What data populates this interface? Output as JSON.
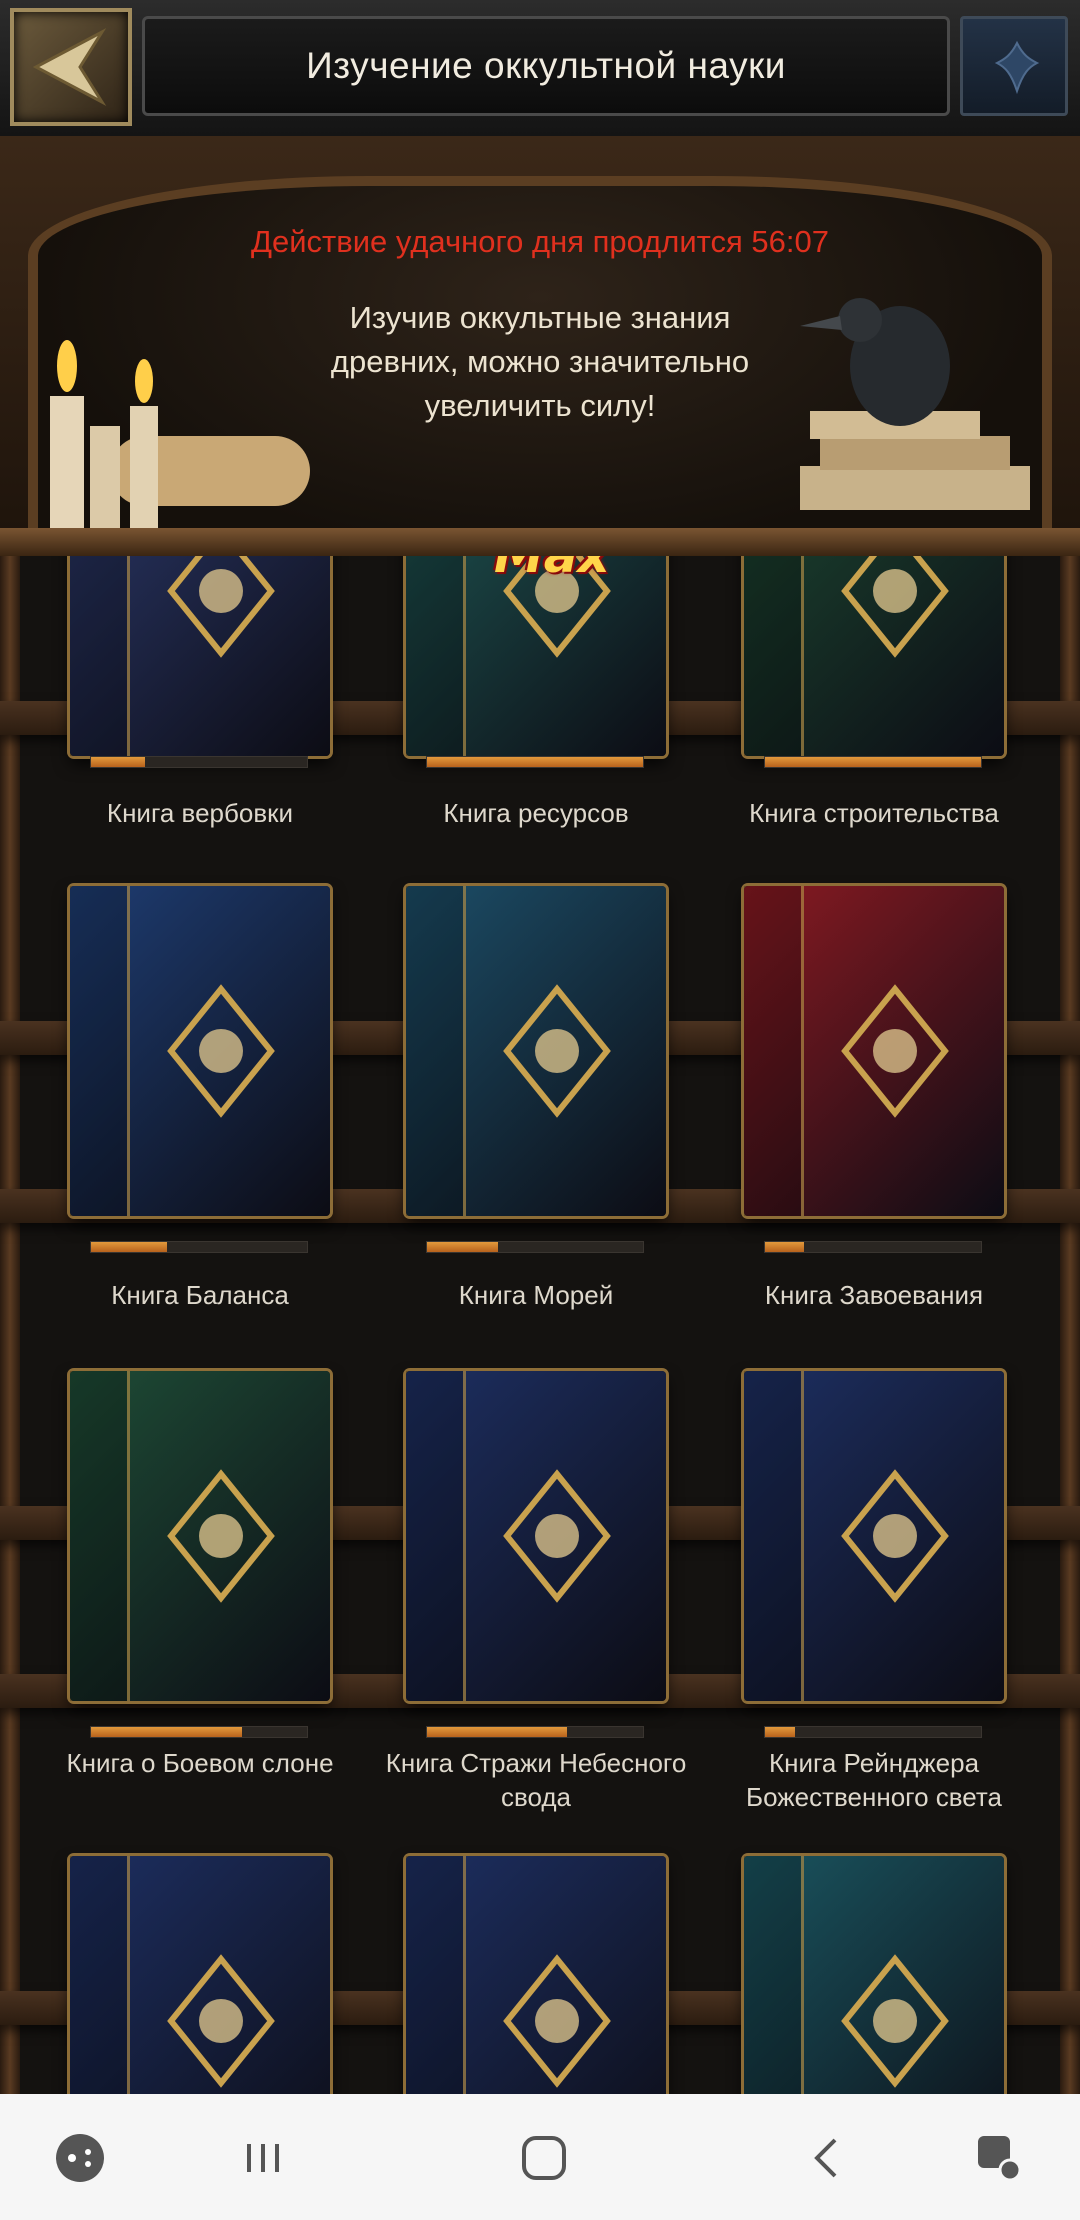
{
  "header": {
    "title": "Изучение оккультной науки",
    "back_icon": "back-arrow-icon",
    "corner_icon": "fleur-emblem-icon"
  },
  "banner": {
    "timer_text": "Действие удачного дня продлится 56:07",
    "description": "Изучив оккультные знания древних, можно значительно увеличить силу!"
  },
  "books": [
    {
      "label": "Книга вербовки",
      "progress": 0.25,
      "color": "#2c3a6e",
      "badge": ""
    },
    {
      "label": "Книга ресурсов",
      "progress": 1.0,
      "color": "#1f5a56",
      "badge": "Max"
    },
    {
      "label": "Книга строительства",
      "progress": 1.0,
      "color": "#1d4a33",
      "badge": ""
    },
    {
      "label": "Книга Баланса",
      "progress": 0.35,
      "color": "#1e3d73",
      "badge": ""
    },
    {
      "label": "Книга Морей",
      "progress": 0.33,
      "color": "#1c4e68",
      "badge": ""
    },
    {
      "label": "Книга Завоевания",
      "progress": 0.18,
      "color": "#8a1a22",
      "badge": ""
    },
    {
      "label": "Книга о Боевом слоне",
      "progress": 0.7,
      "color": "#1e4c36",
      "badge": ""
    },
    {
      "label": "Книга Стражи Небесного свода",
      "progress": 0.65,
      "color": "#1d2f62",
      "badge": ""
    },
    {
      "label": "Книга Рейнджера Божественного света",
      "progress": 0.14,
      "color": "#1d2f62",
      "badge": ""
    },
    {
      "label": "",
      "progress": 0,
      "color": "#1d2f62",
      "badge": ""
    },
    {
      "label": "",
      "progress": 0,
      "color": "#1d2f62",
      "badge": ""
    },
    {
      "label": "",
      "progress": 0,
      "color": "#1a5560",
      "badge": ""
    }
  ],
  "navbar": {
    "items": [
      "game-tools-icon",
      "recent-apps-icon",
      "home-icon",
      "back-icon",
      "assistive-touch-icon"
    ]
  }
}
